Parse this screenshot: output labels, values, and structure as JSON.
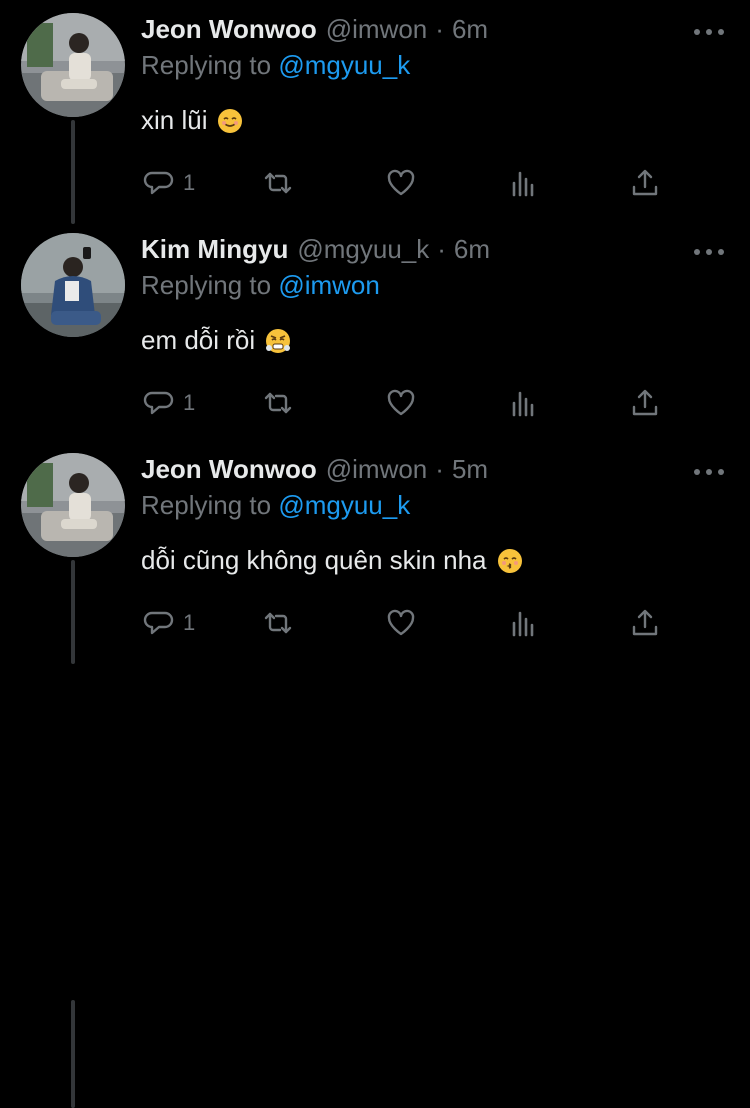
{
  "tweets": [
    {
      "name": "Jeon Wonwoo",
      "handle": "@imwon",
      "separator": "·",
      "time": "6m",
      "replying_prefix": "Replying to",
      "replying_handle": "@mgyuu_k",
      "text": "xin lũi",
      "emoji": "smiling-face-icon",
      "reply_count": "1"
    },
    {
      "name": "Kim Mingyu",
      "handle": "@mgyuu_k",
      "separator": "·",
      "time": "6m",
      "replying_prefix": "Replying to",
      "replying_handle": "@imwon",
      "text": "em dỗi rồi",
      "emoji": "steam-from-nose-face-icon",
      "reply_count": "1"
    },
    {
      "name": "Jeon Wonwoo",
      "handle": "@imwon",
      "separator": "·",
      "time": "5m",
      "replying_prefix": "Replying to",
      "replying_handle": "@mgyuu_k",
      "text": "dỗi cũng không quên skin nha",
      "emoji": "kissing-face-icon",
      "reply_count": "1"
    }
  ],
  "colors": {
    "background": "#000000",
    "primary_text": "#e7e9ea",
    "secondary_text": "#71767b",
    "link": "#1d9bf0",
    "thread_line": "#333639"
  }
}
